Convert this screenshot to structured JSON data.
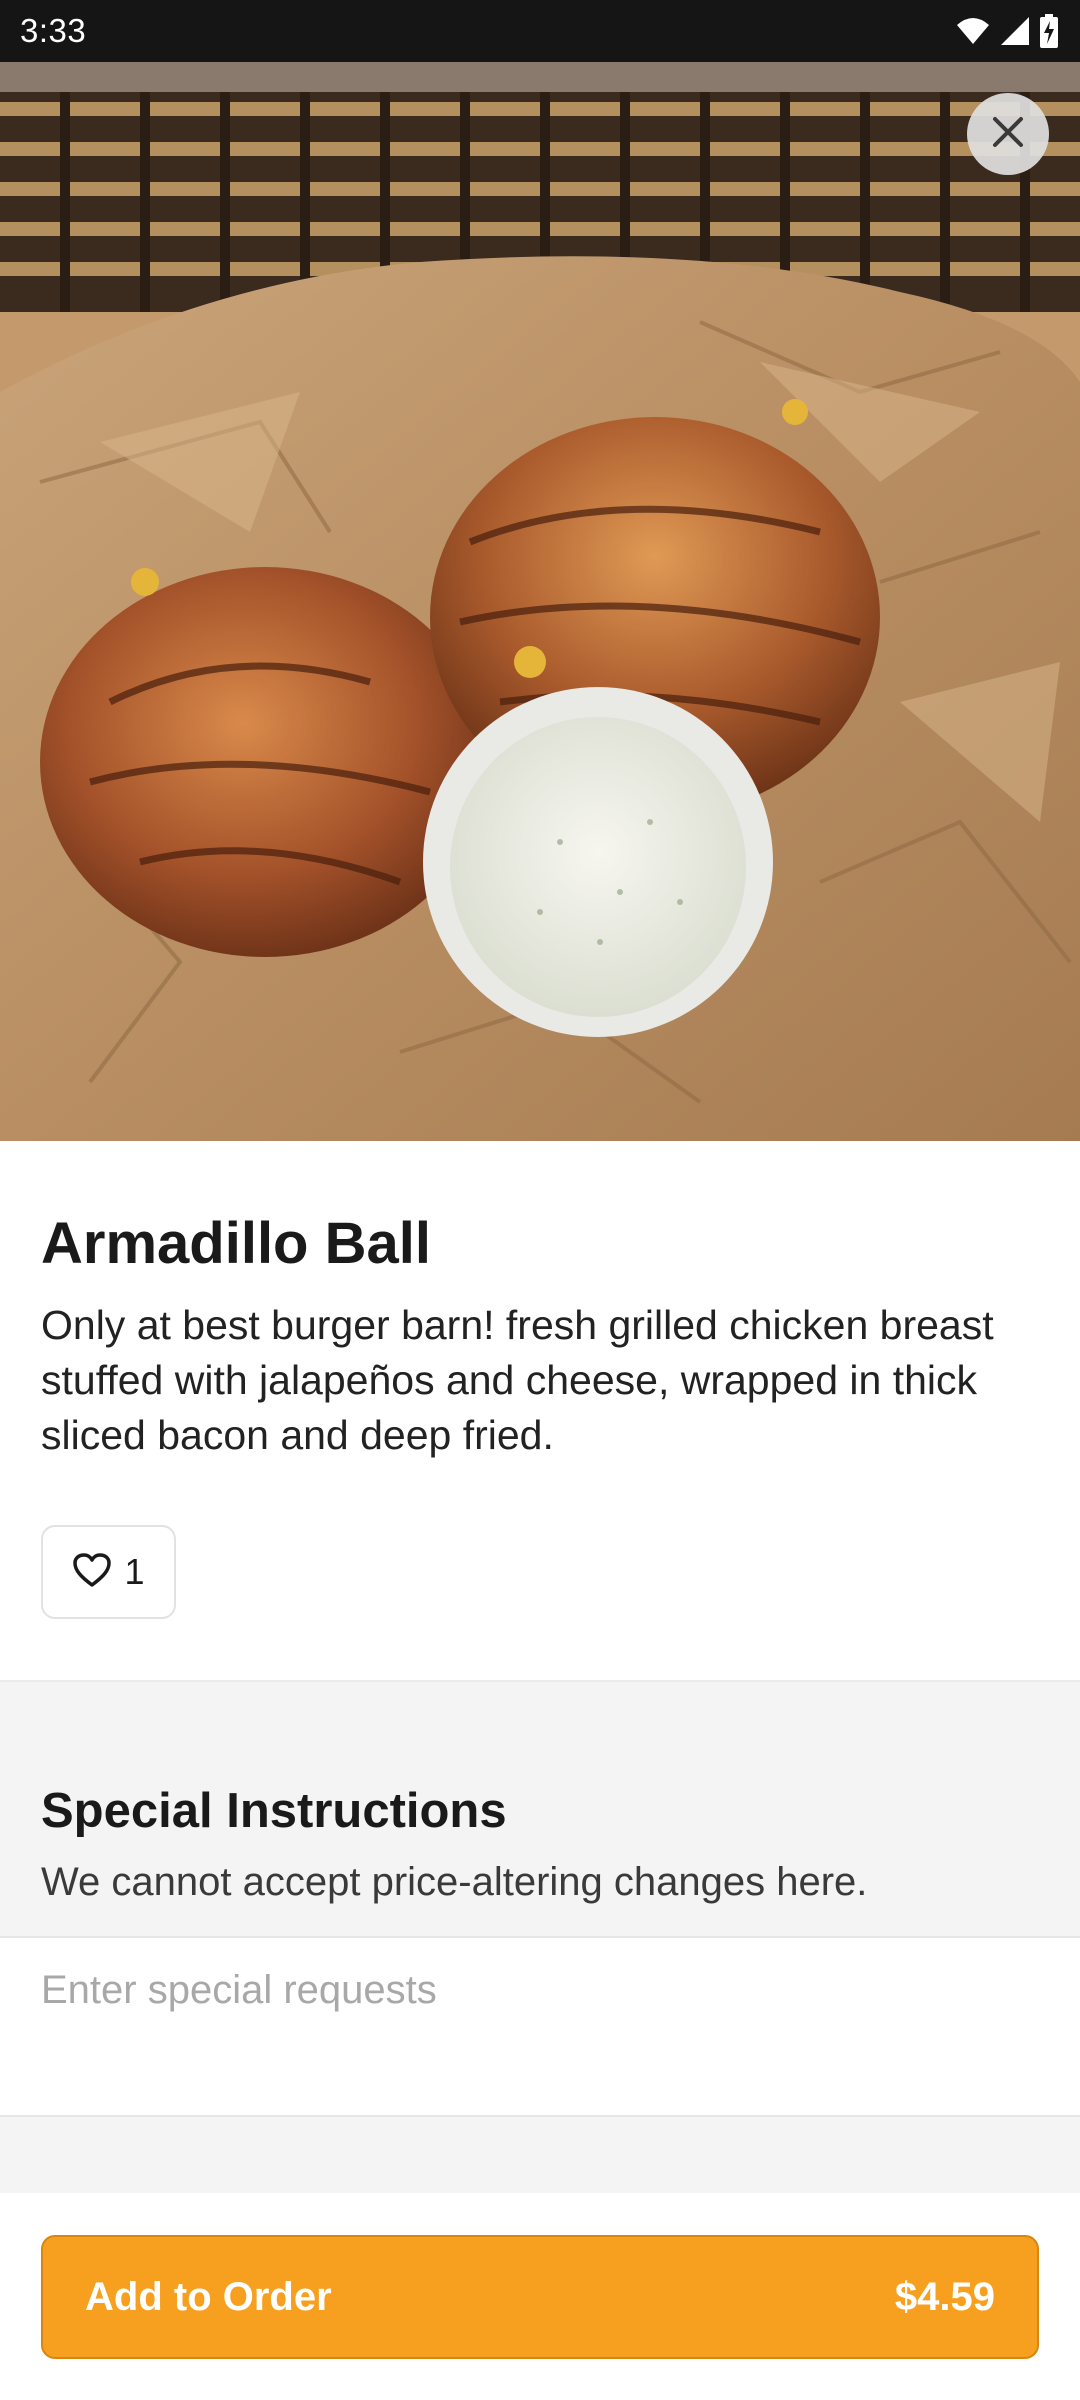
{
  "status_bar": {
    "time": "3:33",
    "icons": [
      "wifi-icon",
      "signal-icon",
      "battery-charging-icon"
    ]
  },
  "hero": {
    "image": "Photo of two bacon-wrapped stuffed chicken balls in a paper-lined basket with a cup of ranch dip",
    "close_icon": "close-icon"
  },
  "item": {
    "title": "Armadillo Ball",
    "description": "Only at best burger barn! fresh grilled chicken breast stuffed with jalapeños and cheese, wrapped in thick sliced bacon and deep fried.",
    "likes": "1",
    "like_icon": "heart-outline-icon"
  },
  "special_instructions": {
    "title": "Special Instructions",
    "subtitle": "We cannot accept price-altering changes here.",
    "placeholder": "Enter special requests",
    "value": ""
  },
  "order": {
    "button_label": "Add to Order",
    "price": "$4.59",
    "accent_color": "#F7A01F"
  }
}
